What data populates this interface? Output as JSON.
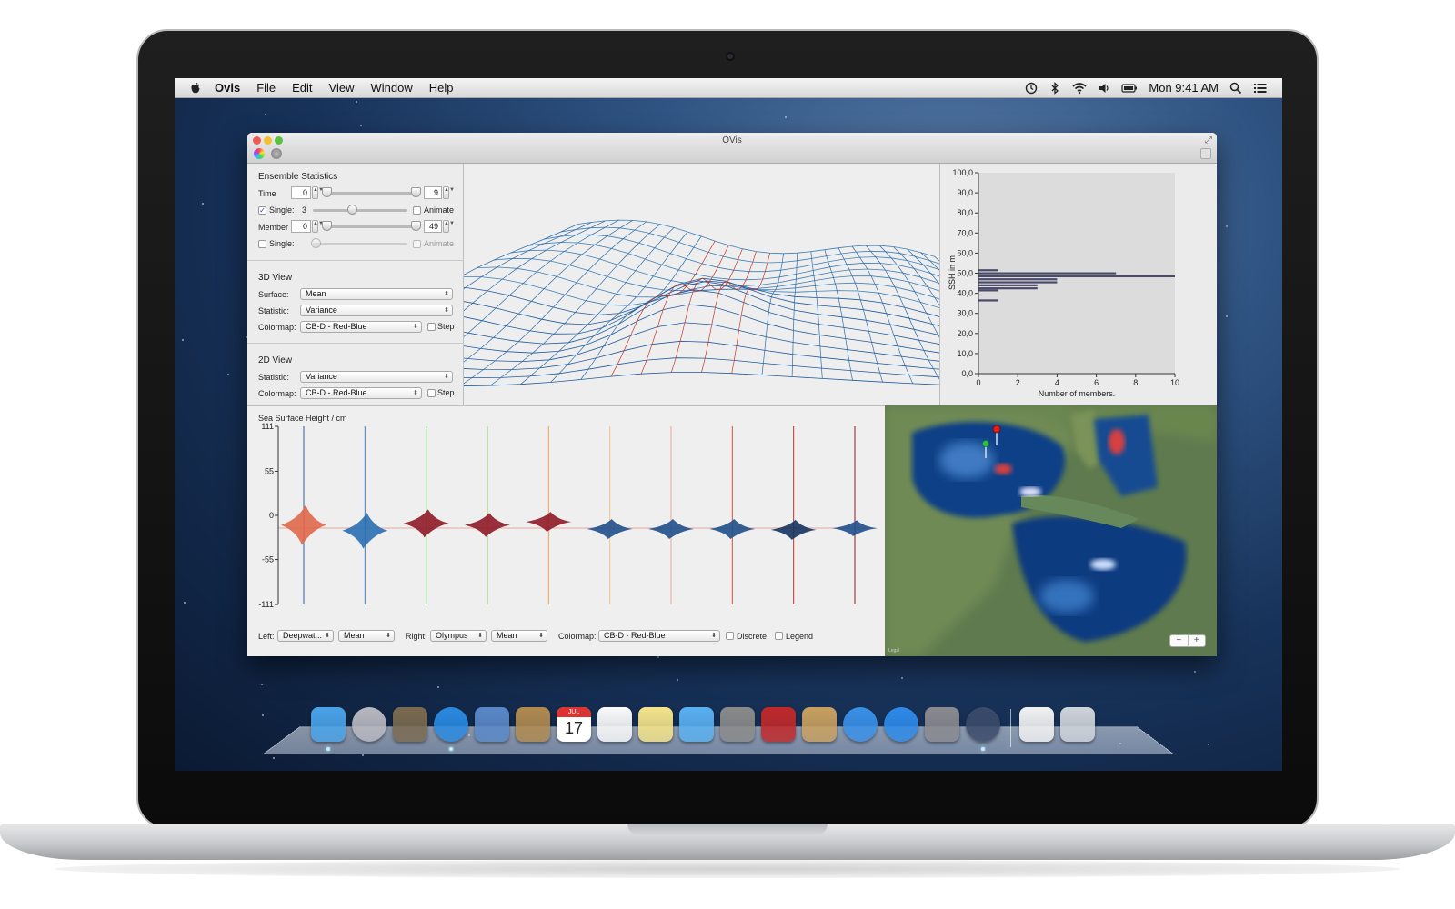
{
  "menubar": {
    "app_name": "Ovis",
    "menus": [
      "File",
      "Edit",
      "View",
      "Window",
      "Help"
    ],
    "clock": "Mon 9:41 AM"
  },
  "window": {
    "title": "OVis",
    "ensemble": {
      "heading": "Ensemble Statistics",
      "time_label": "Time",
      "time_start": "0",
      "time_end": "9",
      "single_label": "Single:",
      "single_value": "3",
      "animate_label": "Animate",
      "member_label": "Member",
      "member_start": "0",
      "member_end": "49",
      "single2_label": "Single:",
      "animate2_label": "Animate"
    },
    "view3d": {
      "heading": "3D View",
      "surface_label": "Surface:",
      "surface_value": "Mean",
      "statistic_label": "Statistic:",
      "statistic_value": "Variance",
      "colormap_label": "Colormap:",
      "colormap_value": "CB-D - Red-Blue",
      "step_label": "Step"
    },
    "view2d": {
      "heading": "2D View",
      "statistic_label": "Statistic:",
      "statistic_value": "Variance",
      "colormap_label": "Colormap:",
      "colormap_value": "CB-D - Red-Blue",
      "step_label": "Step"
    },
    "bottom_controls": {
      "left_label": "Left:",
      "left_source": "Deepwat...",
      "left_stat": "Mean",
      "right_label": "Right:",
      "right_source": "Olympus",
      "right_stat": "Mean",
      "colormap_label": "Colormap:",
      "colormap_value": "CB-D - Red-Blue",
      "discrete_label": "Discrete",
      "legend_label": "Legend"
    },
    "map": {
      "zoom_out": "−",
      "zoom_in": "+",
      "legal": "Legal"
    }
  },
  "colors": {
    "blue_series": "#1f5a9e",
    "red_series": "#9e1f28",
    "hist_bar": "#4a4a6a"
  },
  "chart_data": [
    {
      "type": "bar",
      "orientation": "horizontal",
      "ylabel": "SSH in m",
      "xlabel": "Number of members.",
      "yticks": [
        "0,0",
        "10,0",
        "20,0",
        "30,0",
        "40,0",
        "50,0",
        "60,0",
        "70,0",
        "80,0",
        "90,0",
        "100,0"
      ],
      "xticks": [
        "0",
        "2",
        "4",
        "6",
        "8",
        "10"
      ],
      "xlim": [
        0,
        10
      ],
      "ylim": [
        0,
        100
      ],
      "bins": [
        {
          "ssh": 36.5,
          "members": 1
        },
        {
          "ssh": 41.5,
          "members": 1
        },
        {
          "ssh": 42.5,
          "members": 3
        },
        {
          "ssh": 44.0,
          "members": 3
        },
        {
          "ssh": 45.5,
          "members": 4
        },
        {
          "ssh": 47.0,
          "members": 4
        },
        {
          "ssh": 48.5,
          "members": 10
        },
        {
          "ssh": 50.0,
          "members": 7
        },
        {
          "ssh": 51.5,
          "members": 1
        }
      ]
    },
    {
      "type": "area",
      "title": "Sea Surface Height / cm",
      "yticks": [
        "111",
        "55",
        "0",
        "-55",
        "-111"
      ],
      "ylim": [
        -111,
        111
      ],
      "time_steps": 10,
      "series": [
        {
          "time": 0,
          "color": "#e0684a",
          "mean": -12,
          "spread": 10
        },
        {
          "time": 1,
          "color": "#2a6fb3",
          "mean": -19,
          "spread": 9
        },
        {
          "time": 2,
          "color": "#8e1a26",
          "mean": -10,
          "spread": 7
        },
        {
          "time": 3,
          "color": "#8e1a26",
          "mean": -12,
          "spread": 6
        },
        {
          "time": 4,
          "color": "#8e1a26",
          "mean": -8,
          "spread": 5
        },
        {
          "time": 5,
          "color": "#1f4f8a",
          "mean": -17,
          "spread": 5
        },
        {
          "time": 6,
          "color": "#1f4f8a",
          "mean": -17,
          "spread": 5
        },
        {
          "time": 7,
          "color": "#1f4f8a",
          "mean": -17,
          "spread": 5
        },
        {
          "time": 8,
          "color": "#14335e",
          "mean": -18,
          "spread": 5
        },
        {
          "time": 9,
          "color": "#1f4f8a",
          "mean": -16,
          "spread": 4
        }
      ]
    }
  ],
  "dock": {
    "apps": [
      "finder-icon",
      "launchpad-icon",
      "mission-control-icon",
      "safari-icon",
      "mail-icon",
      "contacts-icon",
      "calendar-icon",
      "reminders-icon",
      "notes-icon",
      "messages-icon",
      "facetime-icon",
      "photo-booth-icon",
      "iphoto-icon",
      "itunes-icon",
      "app-store-icon",
      "system-preferences-icon",
      "ovis-icon",
      "pages-document-icon",
      "trash-icon"
    ],
    "calendar_day": "17",
    "calendar_month": "JUL"
  }
}
